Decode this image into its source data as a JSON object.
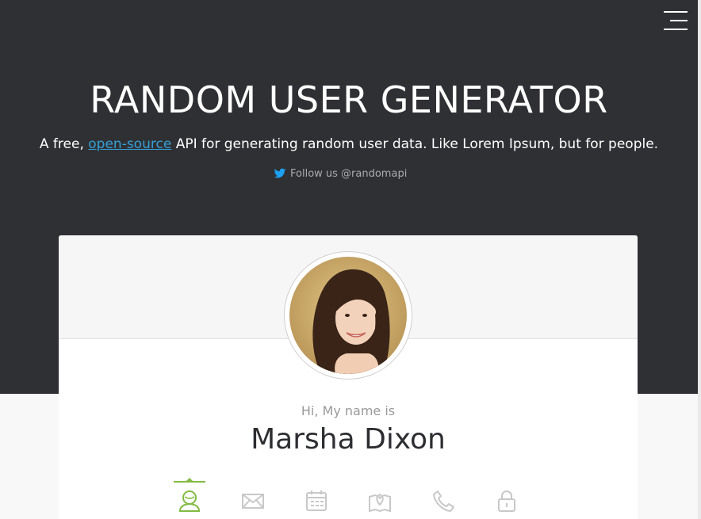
{
  "header": {
    "title": "RANDOM USER GENERATOR",
    "subtitle_before": "A free,",
    "subtitle_link": "open-source",
    "subtitle_after": "API for generating random user data. Like Lorem Ipsum, but for people.",
    "follow_label": "Follow us @randomapi",
    "menu_icon": "hamburger-menu-icon",
    "twitter_icon": "twitter-bird-icon"
  },
  "user": {
    "greeting": "Hi, My name is",
    "name": "Marsha Dixon"
  },
  "tabs": [
    {
      "icon": "user-icon",
      "active": true
    },
    {
      "icon": "envelope-icon",
      "active": false
    },
    {
      "icon": "calendar-icon",
      "active": false
    },
    {
      "icon": "map-icon",
      "active": false
    },
    {
      "icon": "phone-icon",
      "active": false
    },
    {
      "icon": "lock-icon",
      "active": false
    }
  ],
  "colors": {
    "hero_background": "#2f3033",
    "link": "#35a0d8",
    "accent": "#83ba43",
    "icon_inactive": "#c8c8c8"
  }
}
